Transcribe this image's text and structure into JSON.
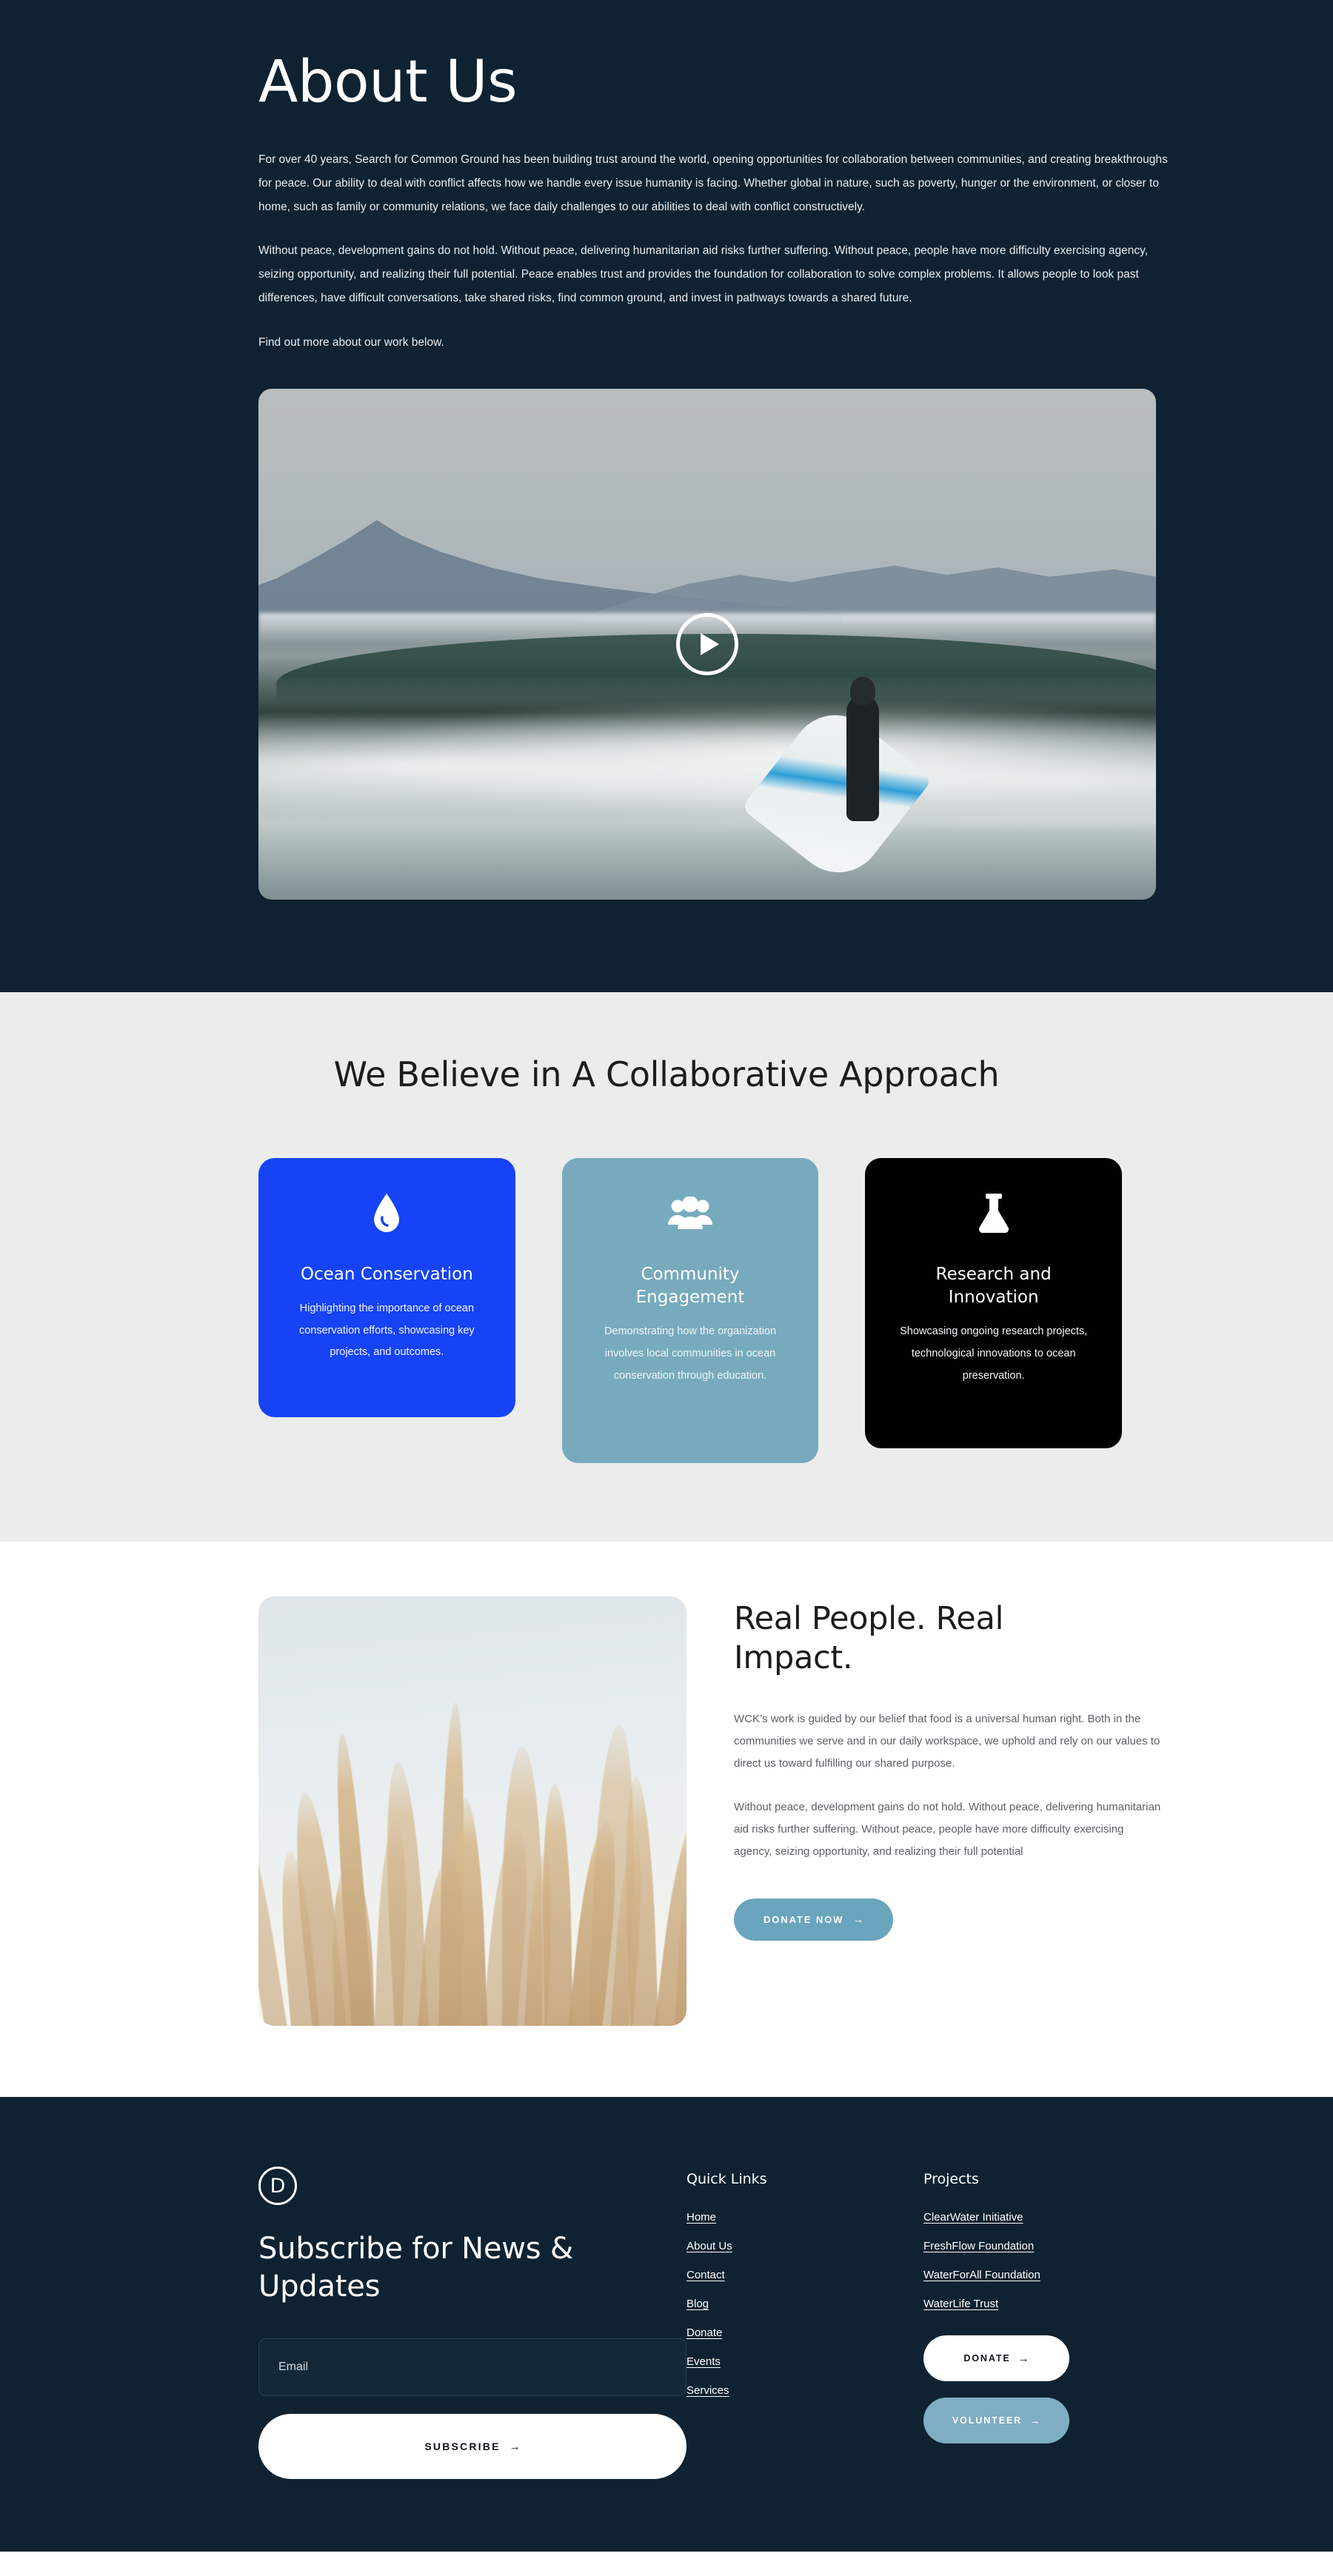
{
  "hero": {
    "title": "About Us",
    "paragraphs": [
      "For over 40 years, Search for Common Ground has been building trust around the world, opening opportunities for collaboration between communities, and creating breakthroughs for peace. Our ability to deal with conflict affects how we handle every issue humanity is facing. Whether global in nature, such as poverty, hunger or the environment, or closer to home, such as family or community relations, we face daily challenges to our abilities to deal with conflict constructively.",
      "Without peace, development gains do not hold. Without peace, delivering humanitarian aid risks further suffering. Without peace, people have more difficulty exercising agency, seizing opportunity, and realizing their full potential. Peace enables trust and provides the foundation for collaboration to solve complex problems. It allows people to look past differences, have difficult conversations, take shared risks, find common ground, and invest in pathways towards a shared future.",
      "Find out more about our work below."
    ],
    "video": {
      "alt": "Surfer carrying a board into ocean waves with mountains behind",
      "play_icon": "play-icon"
    },
    "background_color": "#0e2231"
  },
  "approach": {
    "heading": "We Believe in A Collaborative Approach",
    "background_color": "#ececec",
    "cards": [
      {
        "icon": "water-drop-icon",
        "title": "Ocean Conservation",
        "body": "Highlighting the importance of ocean conservation efforts, showcasing key projects, and outcomes.",
        "color": "#1543f5"
      },
      {
        "icon": "people-group-icon",
        "title": "Community Engagement",
        "body": "Demonstrating how the organization involves local communities in ocean conservation through education.",
        "color": "#77aabd"
      },
      {
        "icon": "flask-icon",
        "title": "Research and Innovation",
        "body": "Showcasing ongoing research projects, technological innovations to ocean preservation.",
        "color": "#010101"
      }
    ]
  },
  "real_people": {
    "image_alt": "Pampas grass plumes against a pale sky",
    "heading": "Real People. Real Impact.",
    "paragraphs": [
      "WCK’s work is guided by our belief that food is a universal human right. Both in the communities we serve and in our daily workspace, we uphold and rely on our values to direct us toward fulfilling our shared purpose.",
      "Without peace, development gains do not hold. Without peace, delivering humanitarian aid risks further suffering. Without peace, people have more difficulty exercising agency, seizing opportunity, and realizing their full potential"
    ],
    "cta": {
      "label": "DONATE NOW",
      "arrow": "→",
      "color": "#6ba4bd"
    }
  },
  "footer": {
    "background_color": "#0e2231",
    "logo": "D",
    "heading": "Subscribe for News & Updates",
    "email_placeholder": "Email",
    "email_value": "",
    "subscribe": {
      "label": "SUBSCRIBE",
      "arrow": "→"
    },
    "quick_links": {
      "title": "Quick Links",
      "items": [
        "Home",
        "About Us",
        "Contact",
        "Blog",
        "Donate",
        "Events",
        "Services"
      ]
    },
    "projects": {
      "title": "Projects",
      "items": [
        "ClearWater Initiative",
        "FreshFlow Foundation",
        "WaterForAll Foundation",
        "WaterLife Trust"
      ],
      "buttons": [
        {
          "label": "DONATE",
          "arrow": "→",
          "style": "white"
        },
        {
          "label": "VOLUNTEER",
          "arrow": "→",
          "style": "teal"
        }
      ]
    }
  }
}
